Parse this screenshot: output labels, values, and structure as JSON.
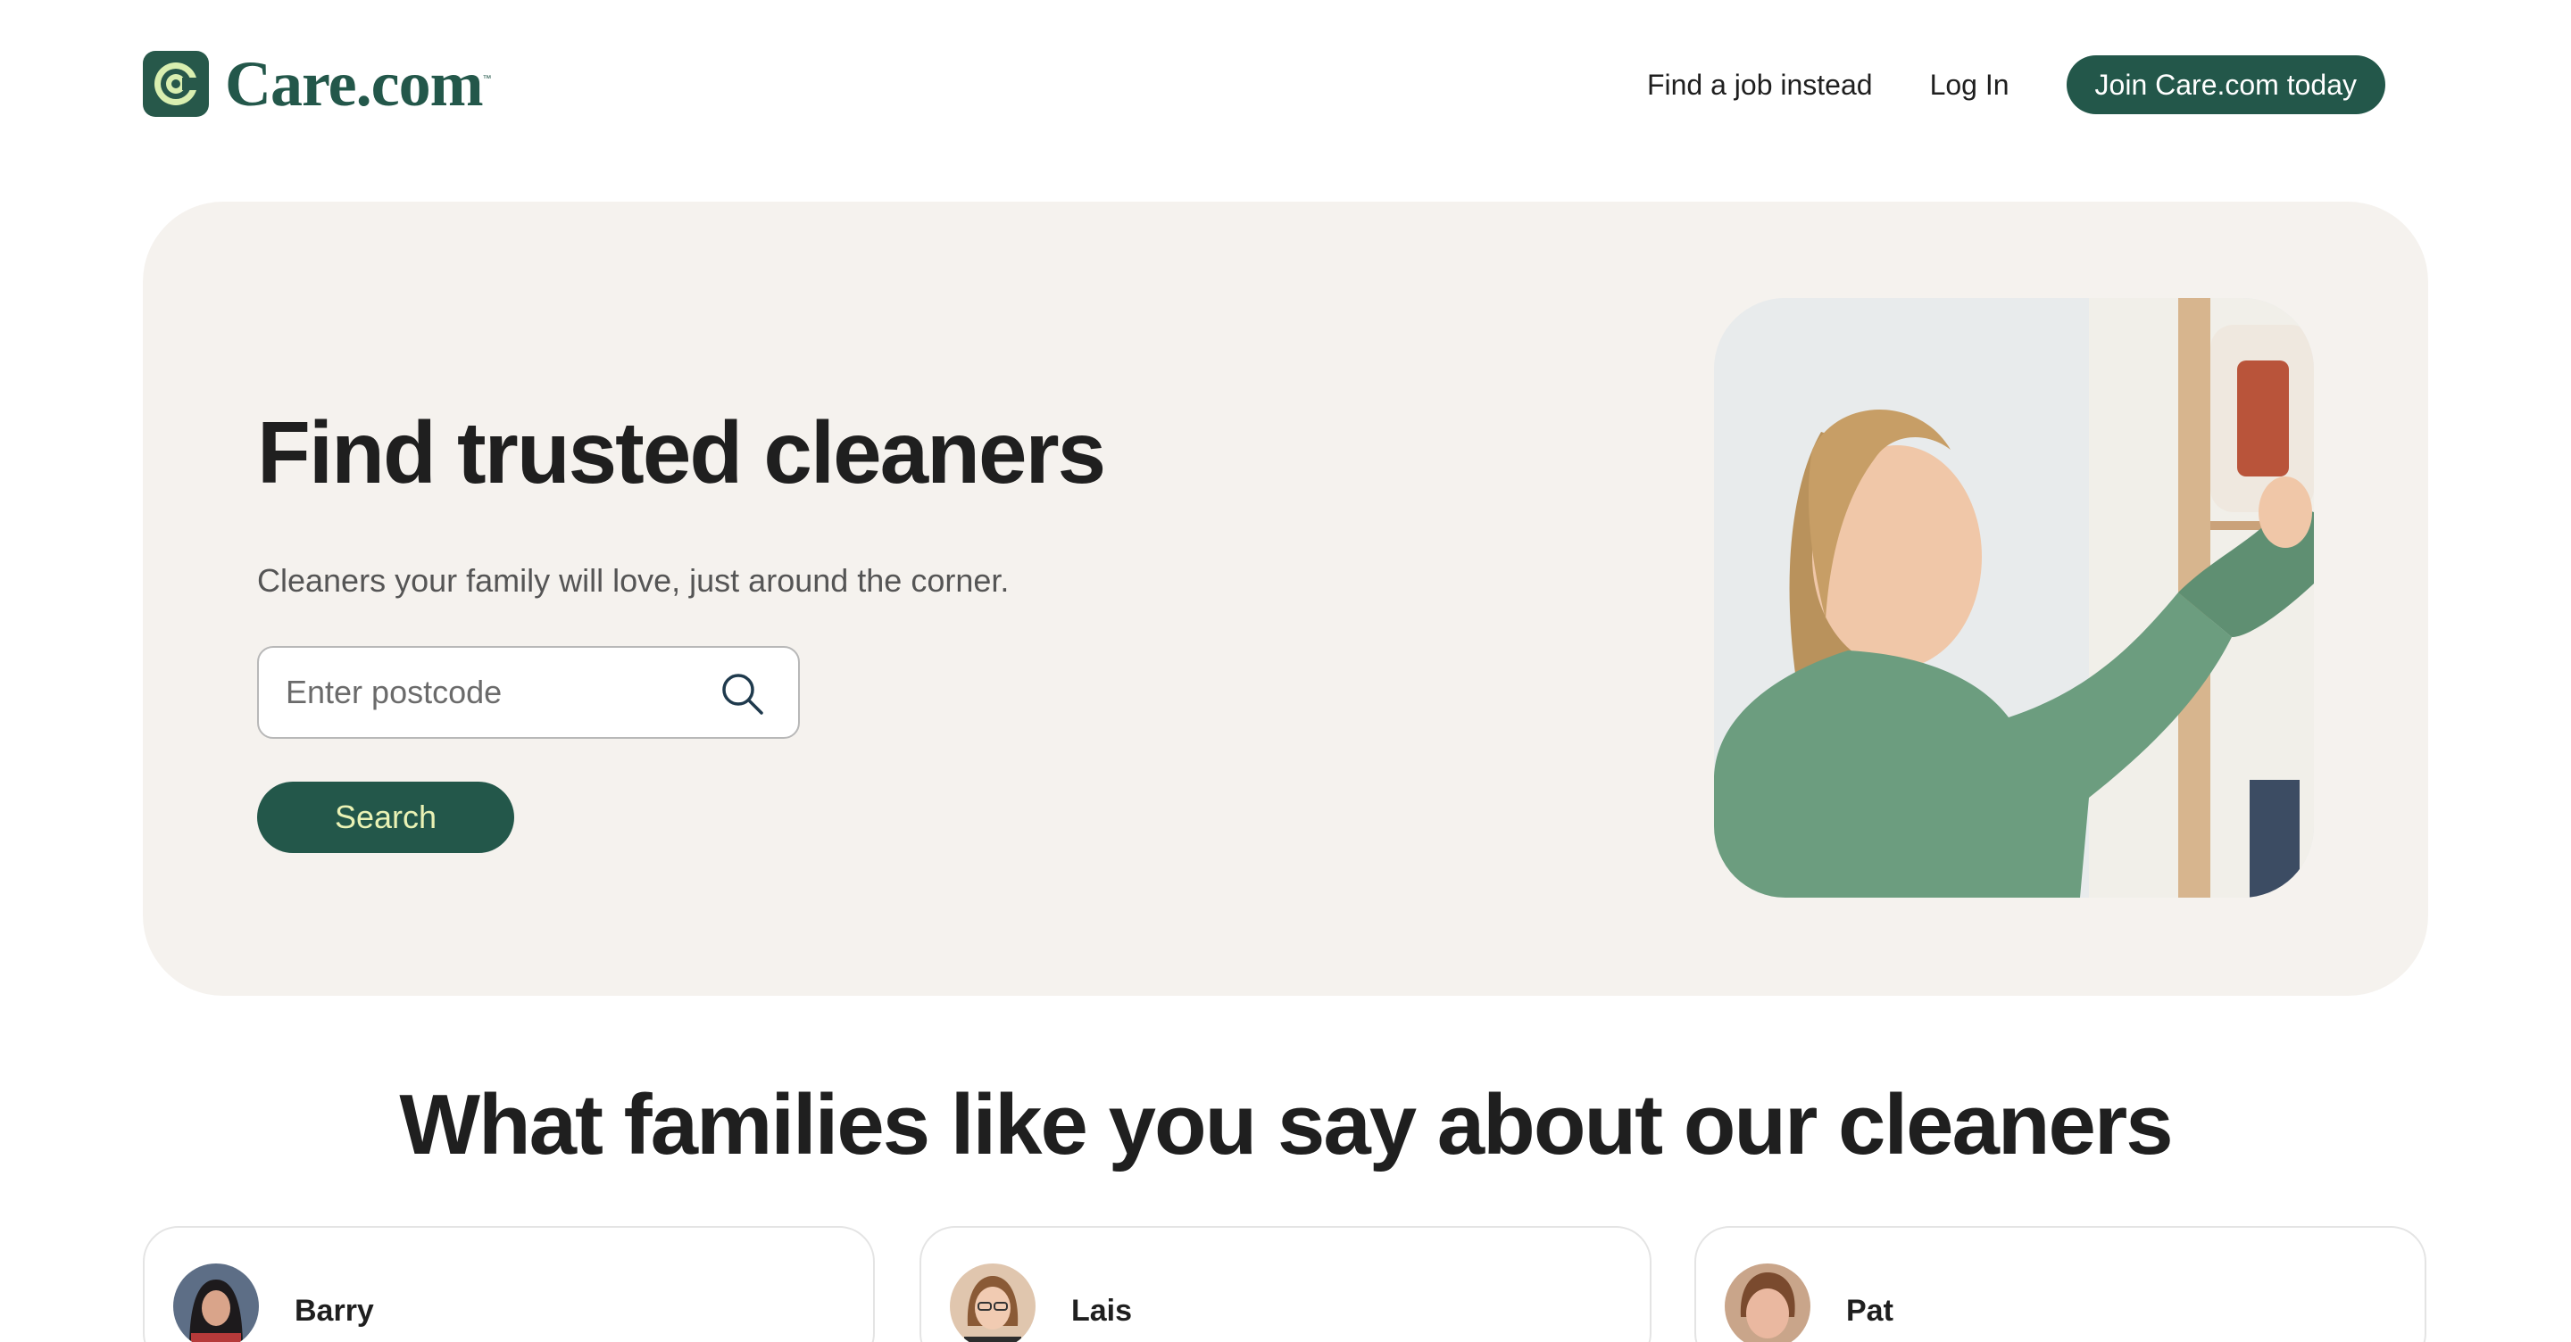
{
  "brand": {
    "name": "Care.com",
    "trademark": "™",
    "color": "#23574a",
    "accent": "#eaf2b5"
  },
  "nav": {
    "find_job": "Find a job instead",
    "login": "Log In",
    "join": "Join Care.com today"
  },
  "hero": {
    "title": "Find trusted cleaners",
    "subtitle": "Cleaners your family will love, just around the corner.",
    "postcode_placeholder": "Enter postcode",
    "search_label": "Search",
    "search_icon": "search-icon",
    "background": "#f5f2ee"
  },
  "testimonials": {
    "title": "What families like you say about our cleaners",
    "cards": [
      {
        "name": "Barry"
      },
      {
        "name": "Lais"
      },
      {
        "name": "Pat"
      }
    ]
  }
}
